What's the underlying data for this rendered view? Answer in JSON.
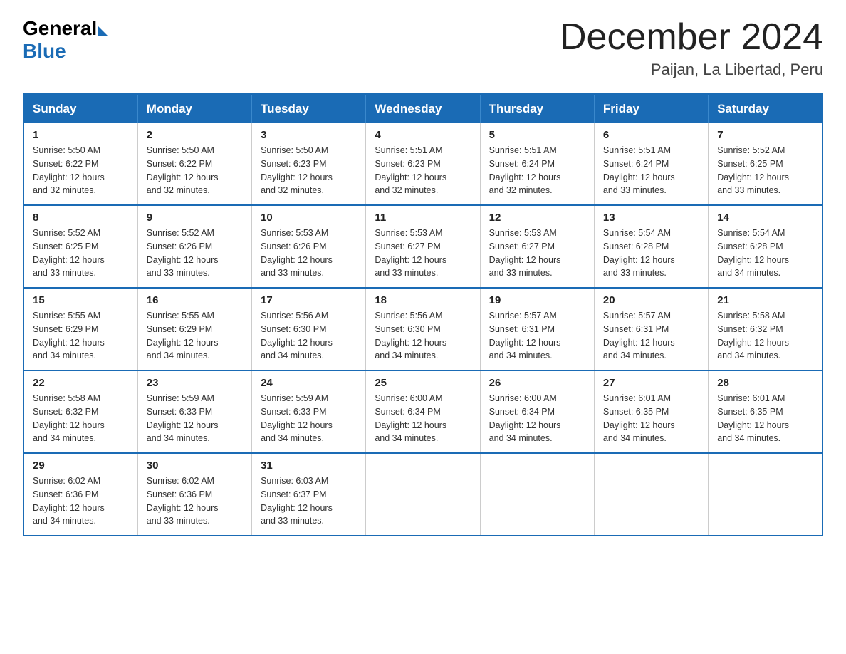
{
  "header": {
    "logo_general": "General",
    "logo_blue": "Blue",
    "month_title": "December 2024",
    "location": "Paijan, La Libertad, Peru"
  },
  "days_of_week": [
    "Sunday",
    "Monday",
    "Tuesday",
    "Wednesday",
    "Thursday",
    "Friday",
    "Saturday"
  ],
  "weeks": [
    [
      {
        "day": 1,
        "sunrise": "5:50 AM",
        "sunset": "6:22 PM",
        "daylight": "12 hours and 32 minutes."
      },
      {
        "day": 2,
        "sunrise": "5:50 AM",
        "sunset": "6:22 PM",
        "daylight": "12 hours and 32 minutes."
      },
      {
        "day": 3,
        "sunrise": "5:50 AM",
        "sunset": "6:23 PM",
        "daylight": "12 hours and 32 minutes."
      },
      {
        "day": 4,
        "sunrise": "5:51 AM",
        "sunset": "6:23 PM",
        "daylight": "12 hours and 32 minutes."
      },
      {
        "day": 5,
        "sunrise": "5:51 AM",
        "sunset": "6:24 PM",
        "daylight": "12 hours and 32 minutes."
      },
      {
        "day": 6,
        "sunrise": "5:51 AM",
        "sunset": "6:24 PM",
        "daylight": "12 hours and 33 minutes."
      },
      {
        "day": 7,
        "sunrise": "5:52 AM",
        "sunset": "6:25 PM",
        "daylight": "12 hours and 33 minutes."
      }
    ],
    [
      {
        "day": 8,
        "sunrise": "5:52 AM",
        "sunset": "6:25 PM",
        "daylight": "12 hours and 33 minutes."
      },
      {
        "day": 9,
        "sunrise": "5:52 AM",
        "sunset": "6:26 PM",
        "daylight": "12 hours and 33 minutes."
      },
      {
        "day": 10,
        "sunrise": "5:53 AM",
        "sunset": "6:26 PM",
        "daylight": "12 hours and 33 minutes."
      },
      {
        "day": 11,
        "sunrise": "5:53 AM",
        "sunset": "6:27 PM",
        "daylight": "12 hours and 33 minutes."
      },
      {
        "day": 12,
        "sunrise": "5:53 AM",
        "sunset": "6:27 PM",
        "daylight": "12 hours and 33 minutes."
      },
      {
        "day": 13,
        "sunrise": "5:54 AM",
        "sunset": "6:28 PM",
        "daylight": "12 hours and 33 minutes."
      },
      {
        "day": 14,
        "sunrise": "5:54 AM",
        "sunset": "6:28 PM",
        "daylight": "12 hours and 34 minutes."
      }
    ],
    [
      {
        "day": 15,
        "sunrise": "5:55 AM",
        "sunset": "6:29 PM",
        "daylight": "12 hours and 34 minutes."
      },
      {
        "day": 16,
        "sunrise": "5:55 AM",
        "sunset": "6:29 PM",
        "daylight": "12 hours and 34 minutes."
      },
      {
        "day": 17,
        "sunrise": "5:56 AM",
        "sunset": "6:30 PM",
        "daylight": "12 hours and 34 minutes."
      },
      {
        "day": 18,
        "sunrise": "5:56 AM",
        "sunset": "6:30 PM",
        "daylight": "12 hours and 34 minutes."
      },
      {
        "day": 19,
        "sunrise": "5:57 AM",
        "sunset": "6:31 PM",
        "daylight": "12 hours and 34 minutes."
      },
      {
        "day": 20,
        "sunrise": "5:57 AM",
        "sunset": "6:31 PM",
        "daylight": "12 hours and 34 minutes."
      },
      {
        "day": 21,
        "sunrise": "5:58 AM",
        "sunset": "6:32 PM",
        "daylight": "12 hours and 34 minutes."
      }
    ],
    [
      {
        "day": 22,
        "sunrise": "5:58 AM",
        "sunset": "6:32 PM",
        "daylight": "12 hours and 34 minutes."
      },
      {
        "day": 23,
        "sunrise": "5:59 AM",
        "sunset": "6:33 PM",
        "daylight": "12 hours and 34 minutes."
      },
      {
        "day": 24,
        "sunrise": "5:59 AM",
        "sunset": "6:33 PM",
        "daylight": "12 hours and 34 minutes."
      },
      {
        "day": 25,
        "sunrise": "6:00 AM",
        "sunset": "6:34 PM",
        "daylight": "12 hours and 34 minutes."
      },
      {
        "day": 26,
        "sunrise": "6:00 AM",
        "sunset": "6:34 PM",
        "daylight": "12 hours and 34 minutes."
      },
      {
        "day": 27,
        "sunrise": "6:01 AM",
        "sunset": "6:35 PM",
        "daylight": "12 hours and 34 minutes."
      },
      {
        "day": 28,
        "sunrise": "6:01 AM",
        "sunset": "6:35 PM",
        "daylight": "12 hours and 34 minutes."
      }
    ],
    [
      {
        "day": 29,
        "sunrise": "6:02 AM",
        "sunset": "6:36 PM",
        "daylight": "12 hours and 34 minutes."
      },
      {
        "day": 30,
        "sunrise": "6:02 AM",
        "sunset": "6:36 PM",
        "daylight": "12 hours and 33 minutes."
      },
      {
        "day": 31,
        "sunrise": "6:03 AM",
        "sunset": "6:37 PM",
        "daylight": "12 hours and 33 minutes."
      },
      null,
      null,
      null,
      null
    ]
  ],
  "labels": {
    "sunrise_prefix": "Sunrise: ",
    "sunset_prefix": "Sunset: ",
    "daylight_prefix": "Daylight: "
  }
}
